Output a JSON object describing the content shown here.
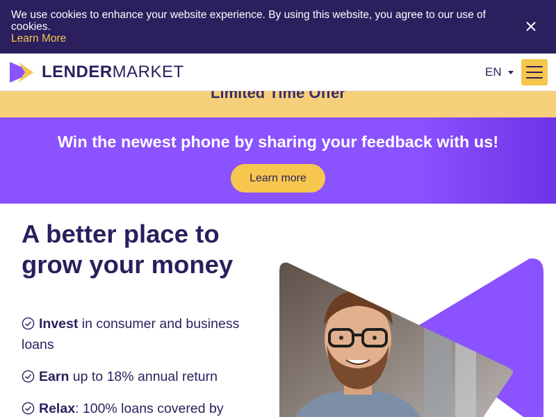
{
  "cookie": {
    "text": "We use cookies to enhance your website experience. By using this website, you agree to our use of cookies.",
    "link": "Learn More",
    "close_icon": "close-icon"
  },
  "header": {
    "logo_text_bold": "LENDER",
    "logo_text_rest": "MARKET",
    "language": "EN",
    "menu_icon": "hamburger-icon"
  },
  "offer": {
    "text": "Limited Time Offer"
  },
  "promo": {
    "title": "Win the newest phone by sharing your feedback with us!",
    "button": "Learn more"
  },
  "hero": {
    "title": "A better place to grow your money",
    "features": [
      {
        "bold": "Invest",
        "rest": " in consumer and business loans"
      },
      {
        "bold": "Earn",
        "rest": " up to 18% annual return"
      },
      {
        "bold": "Relax",
        "rest": ": 100% loans covered by"
      }
    ]
  },
  "colors": {
    "navy": "#2b1f5e",
    "accent_yellow": "#f7c64e",
    "purple": "#8b52ff",
    "offer_yellow": "#f6cf7b"
  }
}
